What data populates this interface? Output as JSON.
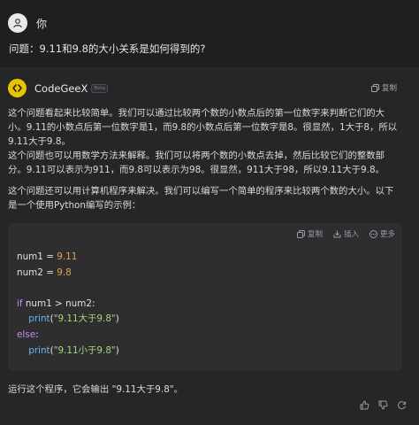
{
  "user": {
    "name": "你",
    "icon": "user-icon"
  },
  "question": "问题：9.11和9.8的大小关系是如何得到的?",
  "bot": {
    "name": "CodeGeeX",
    "badge": "Beta",
    "icon": "codegeex-logo-icon",
    "accent": "#e6c400",
    "copy_label": "复制"
  },
  "answer": {
    "para1": [
      "这个问题看起来比较简单。我们可以通过比较两个数的小数点后的第一位数字来判断它们的大",
      "小。9.11的小数点后第一位数字是1，而9.8的小数点后第一位数字是8。很显然，1大于8，所以",
      "9.11大于9.8。"
    ],
    "para2": [
      "这个问题也可以用数学方法来解释。我们可以将两个数的小数点去掉，然后比较它们的整数部",
      "分。9.11可以表示为911，而9.8可以表示为98。很显然，911大于98，所以9.11大于9.8。"
    ],
    "para3": [
      "这个问题还可以用计算机程序来解决。我们可以编写一个简单的程序来比较两个数的大小。以下",
      "是一个使用Python编写的示例："
    ]
  },
  "code_toolbar": {
    "copy": "复制",
    "insert": "插入",
    "more": "更多"
  },
  "code": {
    "l1": {
      "var": "num1",
      "op": " = ",
      "val": "9.11"
    },
    "l2": {
      "var": "num2",
      "op": " = ",
      "val": "9.8"
    },
    "l4": {
      "kw": "if",
      "cond": " num1 > num2:"
    },
    "l5": {
      "fn": "print",
      "open": "(",
      "str": "\"9.11大于9.8\"",
      "close": ")"
    },
    "l6": {
      "kw": "else",
      "colon": ":"
    },
    "l7": {
      "fn": "print",
      "open": "(",
      "str": "\"9.11小于9.8\"",
      "close": ")"
    }
  },
  "footer": "运行这个程序，它会输出 \"9.11大于9.8\"。",
  "feedback": {
    "like": "thumbs-up-icon",
    "dislike": "thumbs-down-icon",
    "refresh": "refresh-icon"
  }
}
